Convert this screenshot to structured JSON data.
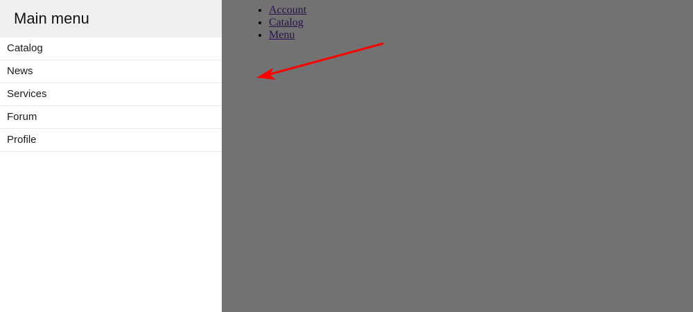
{
  "drawer": {
    "title": "Main menu",
    "items": [
      {
        "label": "Catalog"
      },
      {
        "label": "News"
      },
      {
        "label": "Services"
      },
      {
        "label": "Forum"
      },
      {
        "label": "Profile"
      }
    ]
  },
  "page": {
    "links": [
      {
        "label": "Account"
      },
      {
        "label": "Catalog"
      },
      {
        "label": "Menu"
      }
    ]
  },
  "colors": {
    "overlay": "#727272",
    "drawer_header": "#f0f0f0",
    "arrow": "#ff0000",
    "link": "#2a0e4f"
  },
  "annotation": {
    "icon": "red-arrow-icon"
  }
}
